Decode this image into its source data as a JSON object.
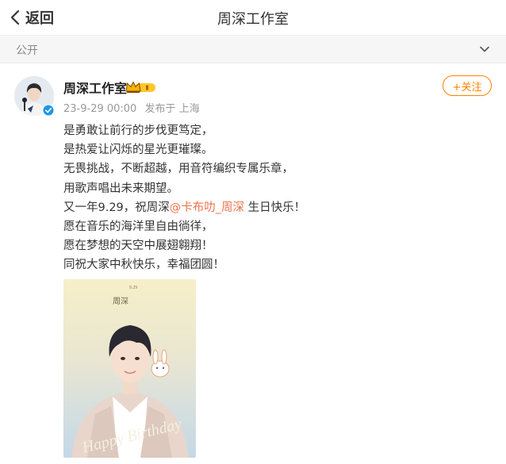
{
  "nav": {
    "back_label": "返回",
    "title": "周深工作室"
  },
  "visibility": {
    "label": "公开"
  },
  "user": {
    "name": "周深工作室",
    "timestamp": "23-9-29 00:00",
    "source": "发布于 上海",
    "follow_label": "+关注"
  },
  "post": {
    "lines": [
      "是勇敢让前行的步伐更笃定，",
      "是热爱让闪烁的星光更璀璨。",
      "无畏挑战，不断超越，用音符编织专属乐章，",
      "用歌声唱出未来期望。"
    ],
    "line5_prefix": "又一年9.29，祝周深",
    "mention": "@卡布叻_周深",
    "line5_suffix": " 生日快乐！",
    "lines_after": [
      "愿在音乐的海洋里自由徜徉，",
      "愿在梦想的天空中展翅翱翔！",
      "同祝大家中秋快乐，幸福团圆！"
    ]
  },
  "poster": {
    "date": "9.29",
    "name": "周深",
    "greeting": "Happy Birthday"
  },
  "colors": {
    "accent": "#ff8200",
    "mention": "#eb7350",
    "meta": "#999999"
  }
}
